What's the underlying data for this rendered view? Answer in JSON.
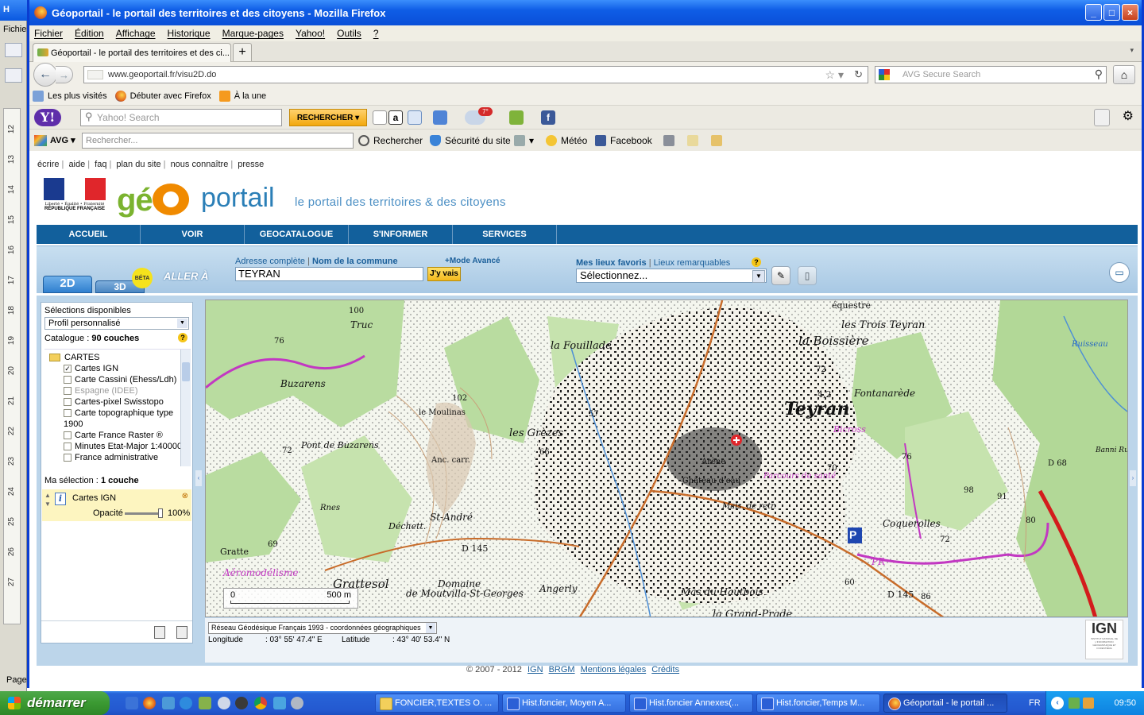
{
  "background_window": {
    "title_fragment": "H",
    "menu_fragment": "Fichie",
    "ruler_marks": [
      "12",
      "13",
      "14",
      "15",
      "16",
      "17",
      "18",
      "19",
      "20",
      "21",
      "22",
      "23",
      "24",
      "25",
      "26",
      "27"
    ],
    "page_label": "Page"
  },
  "browser": {
    "title": "Géoportail - le portail des territoires et des citoyens - Mozilla Firefox",
    "menu": [
      "Fichier",
      "Édition",
      "Affichage",
      "Historique",
      "Marque-pages",
      "Yahoo!",
      "Outils",
      "?"
    ],
    "tab_title": "Géoportail - le portail des territoires et des ci...",
    "new_tab": "+",
    "url": "www.geoportail.fr/visu2D.do",
    "search_placeholder": "AVG Secure Search",
    "bookmarks": [
      "Les plus visités",
      "Débuter avec Firefox",
      "À la une"
    ],
    "window_buttons": {
      "minimize": "_",
      "maximize": "□",
      "close": "×"
    }
  },
  "yahoo_toolbar": {
    "logo": "Y!",
    "search_placeholder": "Yahoo! Search",
    "search_button": "RECHERCHER",
    "weather_badge": "7°"
  },
  "avg_toolbar": {
    "logo": "AVG",
    "search_placeholder": "Rechercher...",
    "items": [
      "Rechercher",
      "Sécurité du site",
      "Météo",
      "Facebook"
    ]
  },
  "site": {
    "top_links": [
      "écrire",
      "aide",
      "faq",
      "plan du site",
      "nous connaître",
      "presse"
    ],
    "republique_motto": "Liberté • Égalité • Fraternité",
    "republique_name": "RÉPUBLIQUE FRANÇAISE",
    "logo_geo": "gé",
    "logo_portail": "portail",
    "tagline": "le portail des territoires & des citoyens",
    "nav": [
      "ACCUEIL",
      "VOIR",
      "GEOCATALOGUE",
      "S'INFORMER",
      "SERVICES"
    ],
    "tab_2d": "2D",
    "tab_3d": "3D",
    "beta": "BÉTA",
    "aller_a": "ALLER À",
    "address_label": "Adresse complète",
    "commune_label": "Nom de la commune",
    "mode_avance": "+Mode Avancé",
    "address_value": "TEYRAN",
    "go_button": "J'y vais",
    "favorites_label": "Mes lieux favoris",
    "remarkable_label": "Lieux remarquables",
    "favorites_select": "Sélectionnez...",
    "help": "?"
  },
  "left_panel": {
    "selections_label": "Sélections disponibles",
    "profile_value": "Profil personnalisé",
    "catalogue_label": "Catalogue :",
    "catalogue_count": "90 couches",
    "folder": "CARTES",
    "layers": [
      {
        "name": "Cartes IGN",
        "checked": true,
        "dim": false
      },
      {
        "name": "Carte Cassini (Ehess/Ldh)",
        "checked": false,
        "dim": false
      },
      {
        "name": "Espagne (IDEE)",
        "checked": false,
        "dim": true
      },
      {
        "name": "Cartes-pixel Swisstopo",
        "checked": false,
        "dim": false
      },
      {
        "name": "Carte topographique type",
        "checked": false,
        "dim": false
      },
      {
        "name": "Carte France Raster ®",
        "checked": false,
        "dim": false
      },
      {
        "name": "Minutes Etat-Major 1:40000",
        "checked": false,
        "dim": false
      },
      {
        "name": "France administrative",
        "checked": false,
        "dim": false
      }
    ],
    "layer_continuation": "1900",
    "my_selection_label": "Ma sélection :",
    "my_selection_count": "1 couche",
    "active_layer": "Cartes IGN",
    "opacity_label": "Opacité",
    "opacity_value": "100%",
    "opacity_fraction": 1.0
  },
  "map": {
    "labels": [
      "équestre",
      "les Trois Teyran",
      "la Boissière",
      "100",
      "Truc",
      "76",
      "la Fouillade",
      "Buzarens",
      "Fontanarède",
      "Teyran",
      "4,2",
      "72",
      "le Moulinas",
      "102",
      "57",
      "les Grèzes",
      "Bicross",
      "Pont de Buzarens",
      "72",
      "Anc. carr.",
      "66",
      "Arène",
      "Château d'eau",
      "Parcours de santé",
      "70",
      "76",
      "Rnes",
      "St-André",
      "Mais. de retr.",
      "Coquerolles",
      "Déchett.",
      "69",
      "D 145",
      "PR",
      "Gratte",
      "Aéromodélisme",
      "Grattesol",
      "Domaine",
      "de Moutvilla-St-Georges",
      "Angerly",
      "Mas du Hautbois",
      "la Grand-Prade",
      "D 145",
      "60",
      "86",
      "98",
      "91",
      "80",
      "72",
      "Banni Ruin",
      "D 68",
      "Ruisseau"
    ],
    "scale_start": "0",
    "scale_end": "500 m",
    "parking": "P"
  },
  "coords": {
    "system": "Réseau Géodésique Français 1993 - coordonnées géographiques",
    "longitude_label": "Longitude",
    "longitude_value": ": 03° 55' 47.4\" E",
    "latitude_label": "Latitude",
    "latitude_value": ": 43° 40' 53.4\" N"
  },
  "ign": {
    "logo": "IGN",
    "sub": "INSTITUT NATIONAL DE L'INFORMATION GÉOGRAPHIQUE ET FORESTIÈRE"
  },
  "footer": {
    "copyright": "© 2007 - 2012",
    "links": [
      "IGN",
      "BRGM",
      "Mentions légales",
      "Crédits"
    ]
  },
  "taskbar": {
    "start": "démarrer",
    "tasks": [
      {
        "label": "FONCIER,TEXTES O. ...",
        "kind": "folder",
        "active": false
      },
      {
        "label": "Hist.foncier, Moyen A...",
        "kind": "word",
        "active": false
      },
      {
        "label": "Hist.foncier Annexes(...",
        "kind": "word",
        "active": false
      },
      {
        "label": "Hist.foncier,Temps M...",
        "kind": "word",
        "active": false
      },
      {
        "label": "Géoportail - le portail ...",
        "kind": "ff",
        "active": true
      }
    ],
    "language": "FR",
    "clock": "09:50"
  },
  "colors": {
    "xp_blue": "#2459d0",
    "geoportail_nav": "#12609c",
    "logo_green": "#7bb32f",
    "logo_orange": "#f08a00",
    "portail_blue": "#2b7fb7"
  }
}
